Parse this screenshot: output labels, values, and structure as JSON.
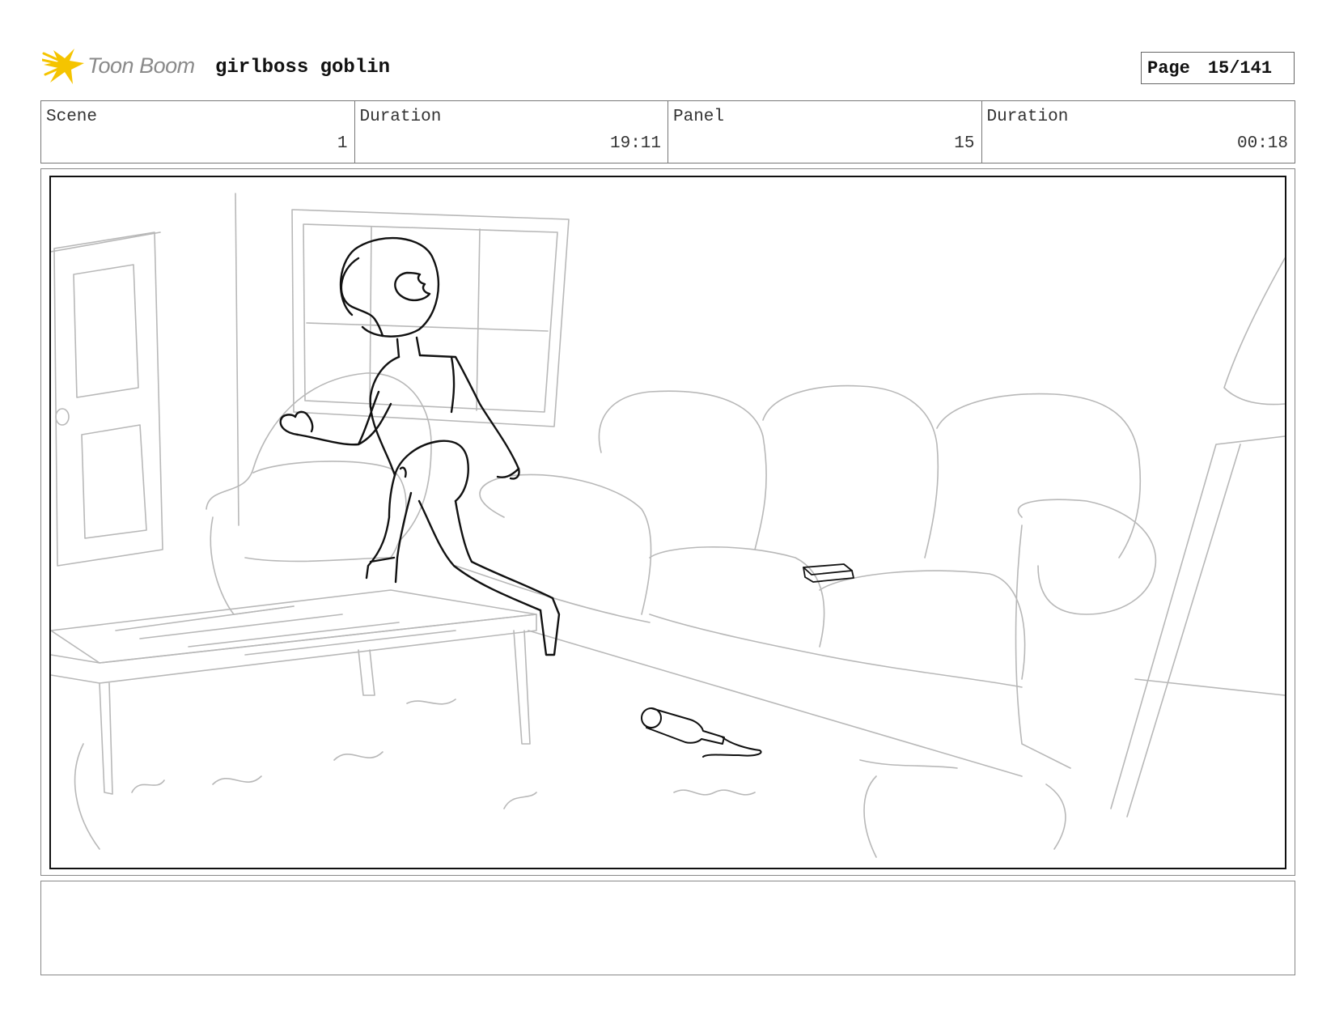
{
  "header": {
    "logo_text": "Toon Boom",
    "project_title": "girlboss goblin",
    "page_label": "Page",
    "page_number": "15/141"
  },
  "info": {
    "scene_label": "Scene",
    "scene_value": "1",
    "scene_duration_label": "Duration",
    "scene_duration_value": "19:11",
    "panel_label": "Panel",
    "panel_value": "15",
    "panel_duration_label": "Duration",
    "panel_duration_value": "00:18"
  },
  "icons": {
    "logo": "toon-boom-star-icon"
  },
  "colors": {
    "logo_star": "#f5c400",
    "logo_text": "#8a8a8a",
    "sketch_rough": "#b8b8b8",
    "sketch_ink": "#111111"
  }
}
